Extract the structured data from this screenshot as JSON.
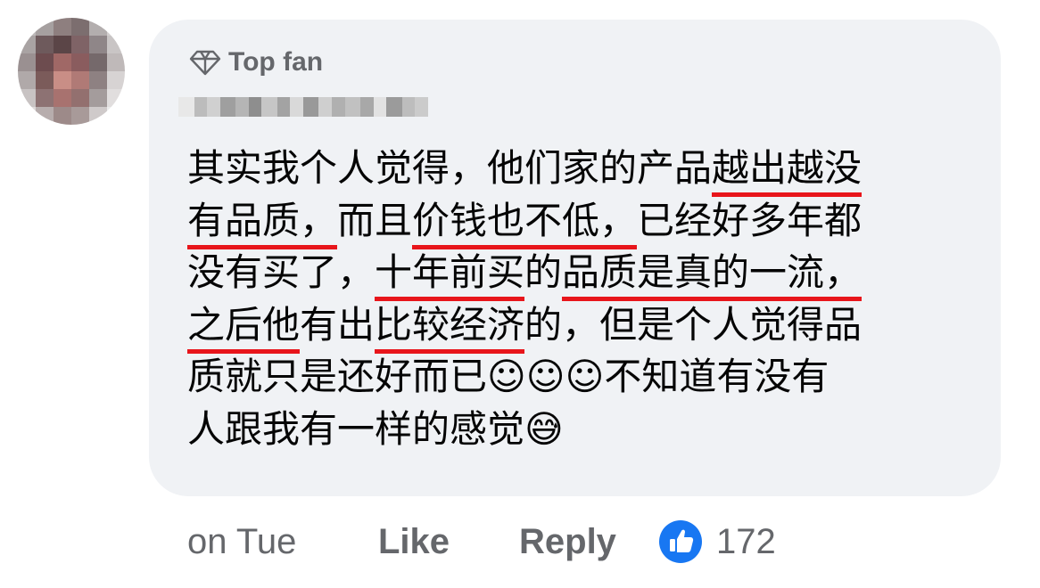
{
  "comment": {
    "badge_label": "Top fan",
    "lines": [
      [
        {
          "t": "其实我个人觉得，他们家的产品",
          "hl": false
        },
        {
          "t": "越出越没",
          "hl": true
        }
      ],
      [
        {
          "t": "有品质，",
          "hl": true
        },
        {
          "t": "而且",
          "hl": false
        },
        {
          "t": "价钱也不低，",
          "hl": true
        },
        {
          "t": "已经好多年都",
          "hl": false
        }
      ],
      [
        {
          "t": "没有买了，",
          "hl": false
        },
        {
          "t": "十年前买",
          "hl": true
        },
        {
          "t": "的",
          "hl": false
        },
        {
          "t": "品质是真的一流，",
          "hl": true
        }
      ],
      [
        {
          "t": "之后他",
          "hl": true
        },
        {
          "t": "有出",
          "hl": false
        },
        {
          "t": "比较经济",
          "hl": true
        },
        {
          "t": "的，但是个人觉得品",
          "hl": false
        }
      ],
      [
        {
          "t": "质就只是还好而已☺☺☺不知道有没有",
          "hl": false
        }
      ],
      [
        {
          "t": "人跟我有一样的感觉😅",
          "hl": false
        }
      ]
    ]
  },
  "actions": {
    "time": "on Tue",
    "like_label": "Like",
    "reply_label": "Reply",
    "reaction_icon": "like-reaction-icon",
    "reaction_count": "172"
  },
  "colors": {
    "bubble_bg": "#f0f2f5",
    "meta_text": "#65676b",
    "underline": "#e8151b",
    "like_blue": "#1877f2"
  }
}
